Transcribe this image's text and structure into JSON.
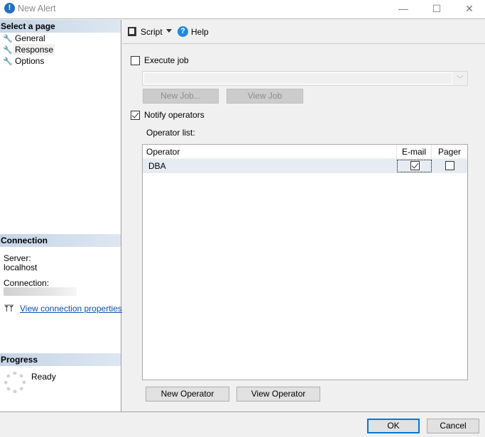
{
  "window": {
    "title": "New Alert",
    "icon": "alert-info-icon",
    "controls": {
      "minimize": "—",
      "maximize": "☐",
      "close": "✕"
    }
  },
  "sidebar": {
    "select_page_header": "Select a page",
    "pages": [
      {
        "label": "General",
        "icon": "wrench-icon",
        "selected": false
      },
      {
        "label": "Response",
        "icon": "wrench-icon",
        "selected": true
      },
      {
        "label": "Options",
        "icon": "wrench-icon",
        "selected": false
      }
    ],
    "connection": {
      "header": "Connection",
      "server_label": "Server:",
      "server_value": "localhost",
      "connection_label": "Connection:",
      "link_label": "View connection properties"
    },
    "progress": {
      "header": "Progress",
      "status": "Ready"
    }
  },
  "toolbar": {
    "script_label": "Script",
    "help_label": "Help",
    "help_glyph": "?"
  },
  "response": {
    "execute_job": {
      "label": "Execute job",
      "checked": false
    },
    "job_combo_value": "",
    "new_job_label": "New Job...",
    "view_job_label": "View Job",
    "notify_operators": {
      "label": "Notify operators",
      "checked": true
    },
    "operator_list_label": "Operator list:",
    "grid": {
      "columns": [
        "Operator",
        "E-mail",
        "Pager"
      ],
      "rows": [
        {
          "operator": "DBA",
          "email": true,
          "pager": false
        }
      ]
    },
    "new_operator_label": "New Operator",
    "view_operator_label": "View Operator"
  },
  "footer": {
    "ok_label": "OK",
    "cancel_label": "Cancel"
  }
}
